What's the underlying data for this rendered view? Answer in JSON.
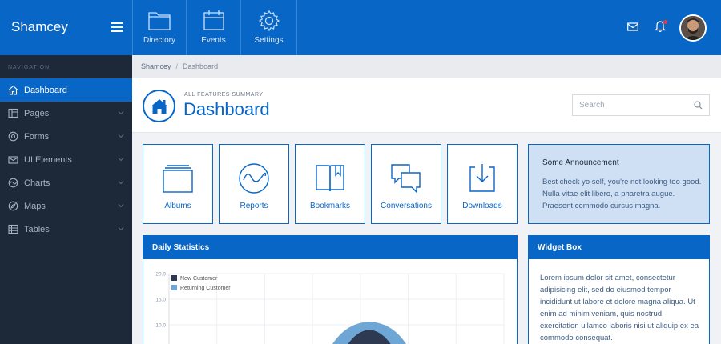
{
  "brand": {
    "name": "Shamcey"
  },
  "topnav": [
    {
      "label": "Directory",
      "icon": "folder-icon"
    },
    {
      "label": "Events",
      "icon": "calendar-icon"
    },
    {
      "label": "Settings",
      "icon": "gear-icon"
    }
  ],
  "header_icons": {
    "mail": "mail-icon",
    "bell": "bell-icon"
  },
  "sidebar": {
    "heading": "NAVIGATION",
    "items": [
      {
        "label": "Dashboard",
        "icon": "home-icon",
        "active": true
      },
      {
        "label": "Pages",
        "icon": "pages-icon"
      },
      {
        "label": "Forms",
        "icon": "forms-icon"
      },
      {
        "label": "UI Elements",
        "icon": "ui-elements-icon"
      },
      {
        "label": "Charts",
        "icon": "charts-icon"
      },
      {
        "label": "Maps",
        "icon": "maps-icon"
      },
      {
        "label": "Tables",
        "icon": "tables-icon"
      }
    ]
  },
  "breadcrumb": {
    "root": "Shamcey",
    "separator": "/",
    "current": "Dashboard"
  },
  "page": {
    "kicker": "ALL FEATURES SUMMARY",
    "title": "Dashboard",
    "search_placeholder": "Search"
  },
  "cards": [
    {
      "label": "Albums",
      "icon": "albums-icon"
    },
    {
      "label": "Reports",
      "icon": "reports-icon"
    },
    {
      "label": "Bookmarks",
      "icon": "bookmarks-icon"
    },
    {
      "label": "Conversations",
      "icon": "conversations-icon"
    },
    {
      "label": "Downloads",
      "icon": "downloads-icon"
    }
  ],
  "announcement": {
    "title": "Some Announcement",
    "text": "Best check yo self, you're not looking too good. Nulla vitae elit libero, a pharetra augue. Praesent commodo cursus magna."
  },
  "stats": {
    "title": "Daily Statistics"
  },
  "widget": {
    "title": "Widget Box",
    "text": "Lorem ipsum dolor sit amet, consectetur adipisicing elit, sed do eiusmod tempor incididunt ut labore et dolore magna aliqua. Ut enim ad minim veniam, quis nostrud exercitation ullamco laboris nisi ut aliquip ex ea commodo consequat."
  },
  "colors": {
    "primary": "#0866c6",
    "sidebar": "#1d2939",
    "series_new": "#2e3a52",
    "series_returning": "#6ea6d6"
  },
  "chart_data": {
    "type": "area",
    "y_ticks": [
      "20.0",
      "15.0",
      "10.0"
    ],
    "ylim": [
      0,
      20
    ],
    "series": [
      {
        "name": "New Customer"
      },
      {
        "name": "Returning Customer"
      }
    ]
  }
}
